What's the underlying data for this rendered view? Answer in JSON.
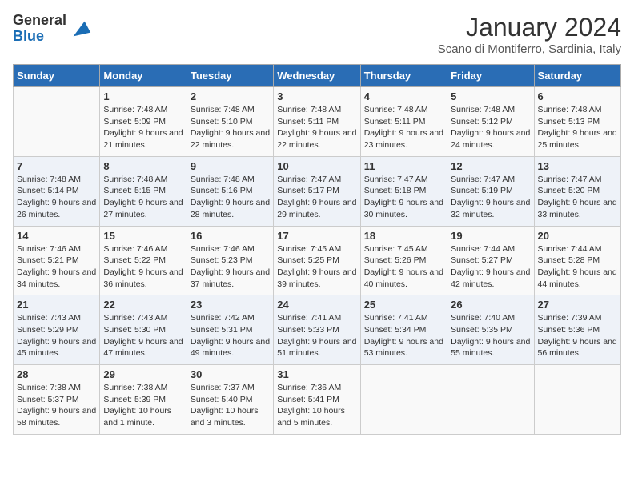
{
  "header": {
    "logo_general": "General",
    "logo_blue": "Blue",
    "month_title": "January 2024",
    "location": "Scano di Montiferro, Sardinia, Italy"
  },
  "days_of_week": [
    "Sunday",
    "Monday",
    "Tuesday",
    "Wednesday",
    "Thursday",
    "Friday",
    "Saturday"
  ],
  "weeks": [
    [
      {
        "day": "",
        "sunrise": "",
        "sunset": "",
        "daylight": ""
      },
      {
        "day": "1",
        "sunrise": "Sunrise: 7:48 AM",
        "sunset": "Sunset: 5:09 PM",
        "daylight": "Daylight: 9 hours and 21 minutes."
      },
      {
        "day": "2",
        "sunrise": "Sunrise: 7:48 AM",
        "sunset": "Sunset: 5:10 PM",
        "daylight": "Daylight: 9 hours and 22 minutes."
      },
      {
        "day": "3",
        "sunrise": "Sunrise: 7:48 AM",
        "sunset": "Sunset: 5:11 PM",
        "daylight": "Daylight: 9 hours and 22 minutes."
      },
      {
        "day": "4",
        "sunrise": "Sunrise: 7:48 AM",
        "sunset": "Sunset: 5:11 PM",
        "daylight": "Daylight: 9 hours and 23 minutes."
      },
      {
        "day": "5",
        "sunrise": "Sunrise: 7:48 AM",
        "sunset": "Sunset: 5:12 PM",
        "daylight": "Daylight: 9 hours and 24 minutes."
      },
      {
        "day": "6",
        "sunrise": "Sunrise: 7:48 AM",
        "sunset": "Sunset: 5:13 PM",
        "daylight": "Daylight: 9 hours and 25 minutes."
      }
    ],
    [
      {
        "day": "7",
        "sunrise": "Sunrise: 7:48 AM",
        "sunset": "Sunset: 5:14 PM",
        "daylight": "Daylight: 9 hours and 26 minutes."
      },
      {
        "day": "8",
        "sunrise": "Sunrise: 7:48 AM",
        "sunset": "Sunset: 5:15 PM",
        "daylight": "Daylight: 9 hours and 27 minutes."
      },
      {
        "day": "9",
        "sunrise": "Sunrise: 7:48 AM",
        "sunset": "Sunset: 5:16 PM",
        "daylight": "Daylight: 9 hours and 28 minutes."
      },
      {
        "day": "10",
        "sunrise": "Sunrise: 7:47 AM",
        "sunset": "Sunset: 5:17 PM",
        "daylight": "Daylight: 9 hours and 29 minutes."
      },
      {
        "day": "11",
        "sunrise": "Sunrise: 7:47 AM",
        "sunset": "Sunset: 5:18 PM",
        "daylight": "Daylight: 9 hours and 30 minutes."
      },
      {
        "day": "12",
        "sunrise": "Sunrise: 7:47 AM",
        "sunset": "Sunset: 5:19 PM",
        "daylight": "Daylight: 9 hours and 32 minutes."
      },
      {
        "day": "13",
        "sunrise": "Sunrise: 7:47 AM",
        "sunset": "Sunset: 5:20 PM",
        "daylight": "Daylight: 9 hours and 33 minutes."
      }
    ],
    [
      {
        "day": "14",
        "sunrise": "Sunrise: 7:46 AM",
        "sunset": "Sunset: 5:21 PM",
        "daylight": "Daylight: 9 hours and 34 minutes."
      },
      {
        "day": "15",
        "sunrise": "Sunrise: 7:46 AM",
        "sunset": "Sunset: 5:22 PM",
        "daylight": "Daylight: 9 hours and 36 minutes."
      },
      {
        "day": "16",
        "sunrise": "Sunrise: 7:46 AM",
        "sunset": "Sunset: 5:23 PM",
        "daylight": "Daylight: 9 hours and 37 minutes."
      },
      {
        "day": "17",
        "sunrise": "Sunrise: 7:45 AM",
        "sunset": "Sunset: 5:25 PM",
        "daylight": "Daylight: 9 hours and 39 minutes."
      },
      {
        "day": "18",
        "sunrise": "Sunrise: 7:45 AM",
        "sunset": "Sunset: 5:26 PM",
        "daylight": "Daylight: 9 hours and 40 minutes."
      },
      {
        "day": "19",
        "sunrise": "Sunrise: 7:44 AM",
        "sunset": "Sunset: 5:27 PM",
        "daylight": "Daylight: 9 hours and 42 minutes."
      },
      {
        "day": "20",
        "sunrise": "Sunrise: 7:44 AM",
        "sunset": "Sunset: 5:28 PM",
        "daylight": "Daylight: 9 hours and 44 minutes."
      }
    ],
    [
      {
        "day": "21",
        "sunrise": "Sunrise: 7:43 AM",
        "sunset": "Sunset: 5:29 PM",
        "daylight": "Daylight: 9 hours and 45 minutes."
      },
      {
        "day": "22",
        "sunrise": "Sunrise: 7:43 AM",
        "sunset": "Sunset: 5:30 PM",
        "daylight": "Daylight: 9 hours and 47 minutes."
      },
      {
        "day": "23",
        "sunrise": "Sunrise: 7:42 AM",
        "sunset": "Sunset: 5:31 PM",
        "daylight": "Daylight: 9 hours and 49 minutes."
      },
      {
        "day": "24",
        "sunrise": "Sunrise: 7:41 AM",
        "sunset": "Sunset: 5:33 PM",
        "daylight": "Daylight: 9 hours and 51 minutes."
      },
      {
        "day": "25",
        "sunrise": "Sunrise: 7:41 AM",
        "sunset": "Sunset: 5:34 PM",
        "daylight": "Daylight: 9 hours and 53 minutes."
      },
      {
        "day": "26",
        "sunrise": "Sunrise: 7:40 AM",
        "sunset": "Sunset: 5:35 PM",
        "daylight": "Daylight: 9 hours and 55 minutes."
      },
      {
        "day": "27",
        "sunrise": "Sunrise: 7:39 AM",
        "sunset": "Sunset: 5:36 PM",
        "daylight": "Daylight: 9 hours and 56 minutes."
      }
    ],
    [
      {
        "day": "28",
        "sunrise": "Sunrise: 7:38 AM",
        "sunset": "Sunset: 5:37 PM",
        "daylight": "Daylight: 9 hours and 58 minutes."
      },
      {
        "day": "29",
        "sunrise": "Sunrise: 7:38 AM",
        "sunset": "Sunset: 5:39 PM",
        "daylight": "Daylight: 10 hours and 1 minute."
      },
      {
        "day": "30",
        "sunrise": "Sunrise: 7:37 AM",
        "sunset": "Sunset: 5:40 PM",
        "daylight": "Daylight: 10 hours and 3 minutes."
      },
      {
        "day": "31",
        "sunrise": "Sunrise: 7:36 AM",
        "sunset": "Sunset: 5:41 PM",
        "daylight": "Daylight: 10 hours and 5 minutes."
      },
      {
        "day": "",
        "sunrise": "",
        "sunset": "",
        "daylight": ""
      },
      {
        "day": "",
        "sunrise": "",
        "sunset": "",
        "daylight": ""
      },
      {
        "day": "",
        "sunrise": "",
        "sunset": "",
        "daylight": ""
      }
    ]
  ]
}
